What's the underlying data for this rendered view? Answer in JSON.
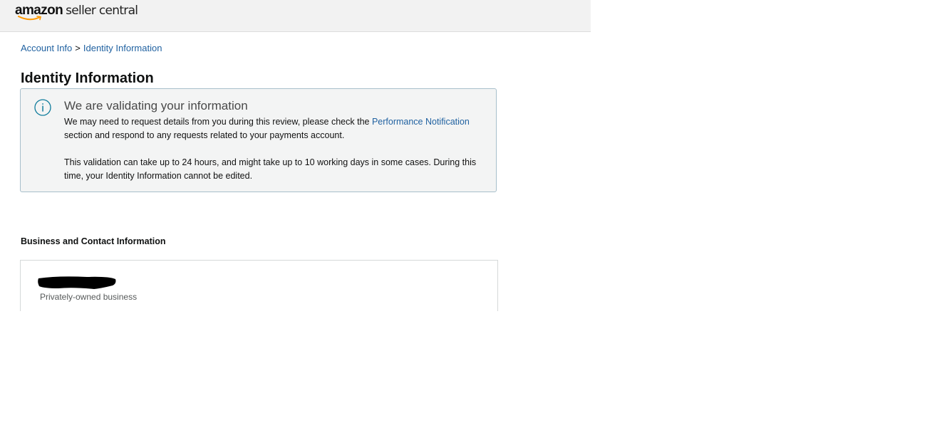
{
  "header": {
    "logo_brand": "amazon",
    "logo_product": "seller central"
  },
  "breadcrumb": {
    "items": [
      {
        "label": "Account Info"
      },
      {
        "label": "Identity Information"
      }
    ],
    "separator": ">"
  },
  "page": {
    "title": "Identity Information"
  },
  "alert": {
    "icon": "info-icon",
    "title": "We are validating your information",
    "para1_before": "We may need to request details from you during this review, please check the ",
    "para1_link": "Performance Notification",
    "para1_after": " section and respond to any requests related to your payments account.",
    "para2": "This validation can take up to 24 hours, and might take up to 10 working days in some cases. During this time, your Identity Information cannot be edited."
  },
  "business_section": {
    "title": "Business and Contact Information",
    "card": {
      "business_type": "Privately-owned business"
    }
  },
  "colors": {
    "link": "#2162a1",
    "header_bg": "#f2f2f2",
    "alert_bg": "#f3f4f4",
    "alert_border": "#a7bfcb",
    "info_icon": "#0f7c9c",
    "logo_smile": "#ff9900"
  }
}
